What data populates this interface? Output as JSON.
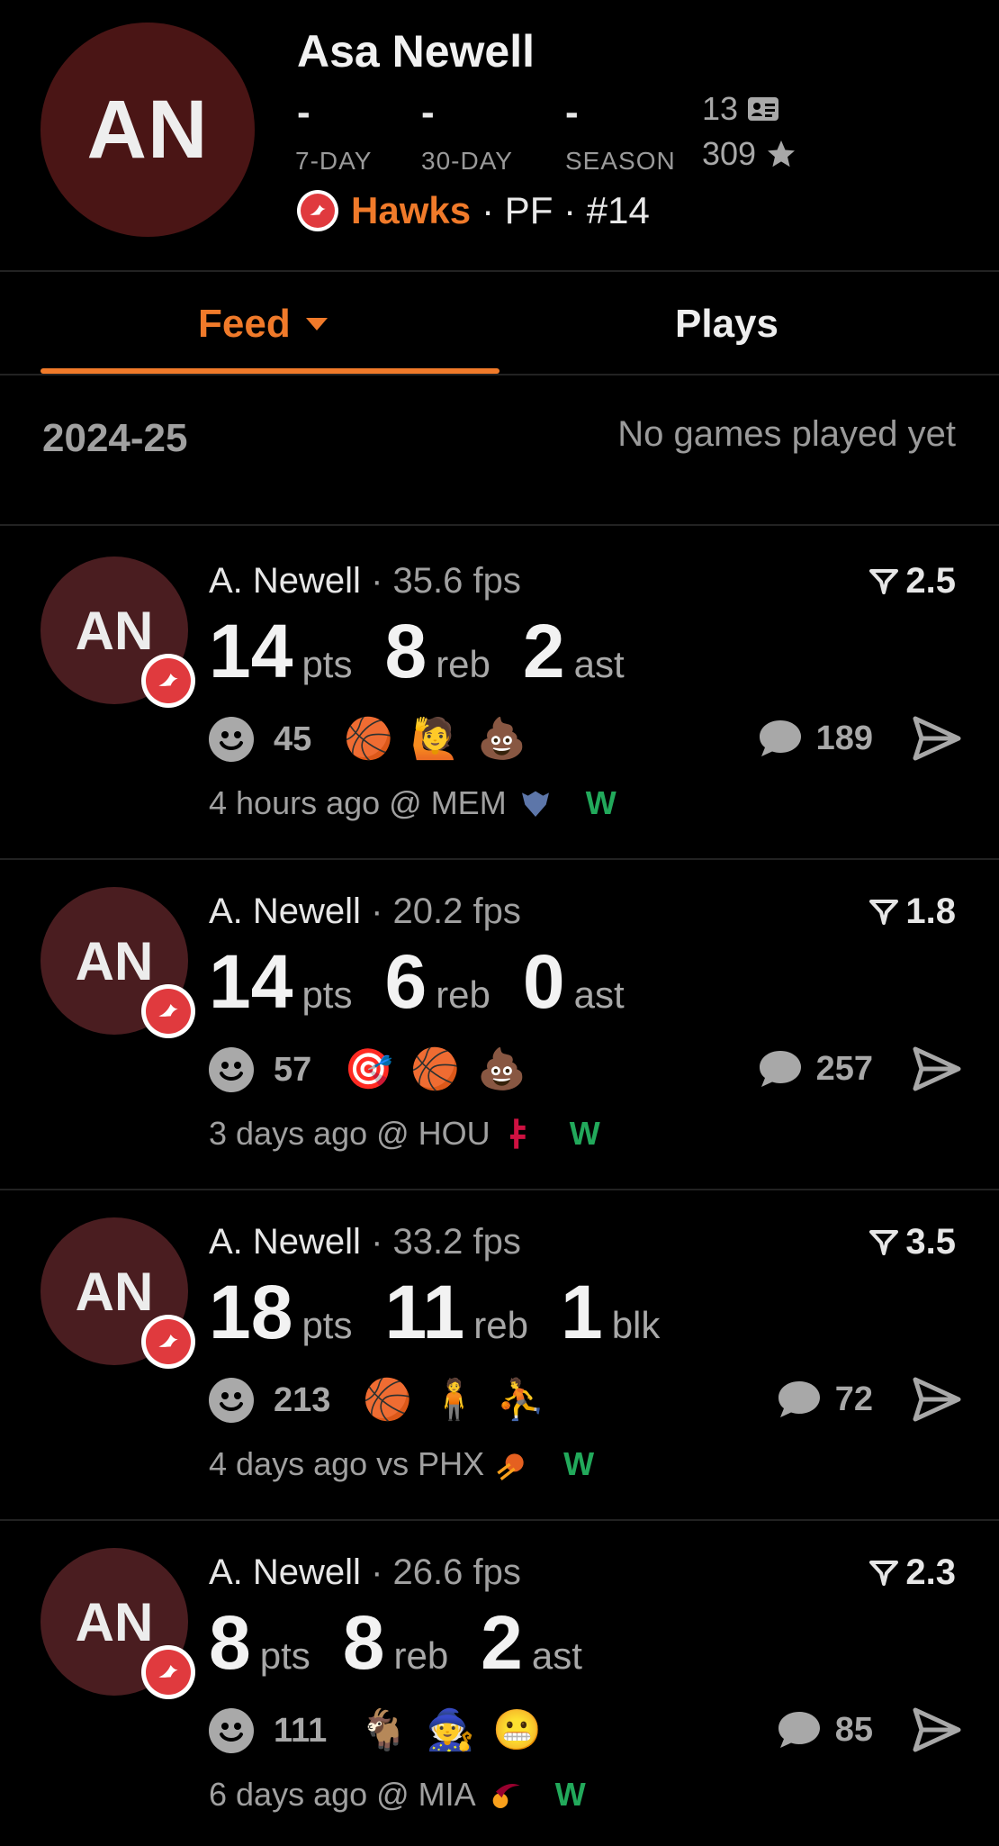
{
  "player": {
    "initials": "AN",
    "name": "Asa Newell",
    "stats": [
      {
        "value": "-",
        "label": "7-DAY"
      },
      {
        "value": "-",
        "label": "30-DAY"
      },
      {
        "value": "-",
        "label": "SEASON"
      }
    ],
    "cards_count": "13",
    "stars_count": "309",
    "team": "Hawks",
    "position_number": "· PF · #14"
  },
  "tabs": {
    "feed": "Feed",
    "plays": "Plays"
  },
  "season": {
    "label": "2024-25",
    "note": "No games played yet"
  },
  "feed": [
    {
      "initials": "AN",
      "name": "A. Newell",
      "fps": "· 35.6 fps",
      "rating": "2.5",
      "stats": [
        {
          "n": "14",
          "u": "pts"
        },
        {
          "n": "8",
          "u": "reb"
        },
        {
          "n": "2",
          "u": "ast"
        }
      ],
      "reactions": "45",
      "emojis": [
        "🏀",
        "🙋",
        "💩"
      ],
      "comments": "189",
      "time": "4 hours ago @ MEM",
      "opp_icon": "grizzlies-logo",
      "result": "W"
    },
    {
      "initials": "AN",
      "name": "A. Newell",
      "fps": "· 20.2 fps",
      "rating": "1.8",
      "stats": [
        {
          "n": "14",
          "u": "pts"
        },
        {
          "n": "6",
          "u": "reb"
        },
        {
          "n": "0",
          "u": "ast"
        }
      ],
      "reactions": "57",
      "emojis": [
        "🎯",
        "🏀",
        "💩"
      ],
      "comments": "257",
      "time": "3 days ago @ HOU",
      "opp_icon": "rockets-logo",
      "result": "W"
    },
    {
      "initials": "AN",
      "name": "A. Newell",
      "fps": "· 33.2 fps",
      "rating": "3.5",
      "stats": [
        {
          "n": "18",
          "u": "pts"
        },
        {
          "n": "11",
          "u": "reb"
        },
        {
          "n": "1",
          "u": "blk"
        }
      ],
      "reactions": "213",
      "emojis": [
        "🏀",
        "🧍",
        "⛹"
      ],
      "comments": "72",
      "time": "4 days ago vs PHX",
      "opp_icon": "suns-logo",
      "result": "W"
    },
    {
      "initials": "AN",
      "name": "A. Newell",
      "fps": "· 26.6 fps",
      "rating": "2.3",
      "stats": [
        {
          "n": "8",
          "u": "pts"
        },
        {
          "n": "8",
          "u": "reb"
        },
        {
          "n": "2",
          "u": "ast"
        }
      ],
      "reactions": "111",
      "emojis": [
        "🐐",
        "🧙",
        "😬"
      ],
      "comments": "85",
      "time": "6 days ago @ MIA",
      "opp_icon": "heat-logo",
      "result": "W"
    }
  ],
  "colors": {
    "accent": "#f07a2a",
    "win": "#22a95b",
    "avatar": "#4a1d20",
    "hawks_red": "#e03a3e"
  }
}
